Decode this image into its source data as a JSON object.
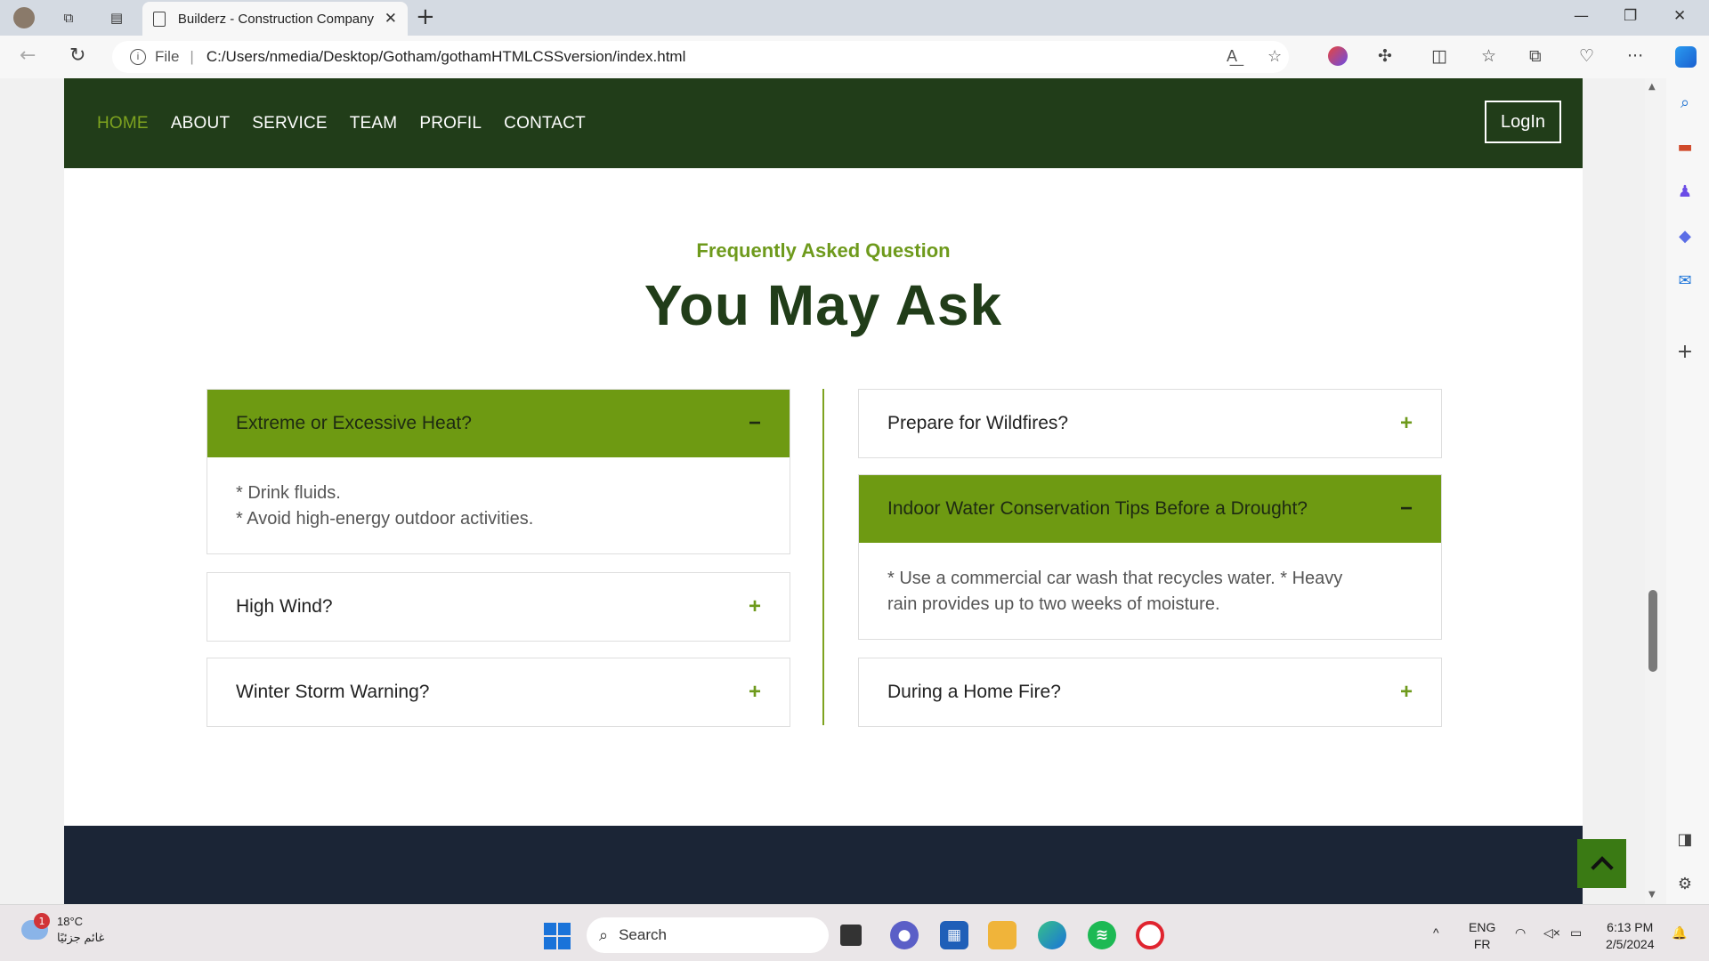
{
  "browser": {
    "tab_title": "Builderz - Construction Company",
    "tab_close": "✕",
    "new_tab": "+",
    "url_scheme_label": "File",
    "url": "C:/Users/nmedia/Desktop/Gotham/gothamHTMLCSSversion/index.html",
    "window_controls": {
      "minimize": "—",
      "restore": "❐",
      "close": "✕"
    },
    "more_label": "···"
  },
  "site": {
    "nav": {
      "items": [
        {
          "label": "HOME",
          "active": true
        },
        {
          "label": "ABOUT",
          "active": false
        },
        {
          "label": "SERVICE",
          "active": false
        },
        {
          "label": "TEAM",
          "active": false
        },
        {
          "label": "PROFIL",
          "active": false
        },
        {
          "label": "CONTACT",
          "active": false
        }
      ],
      "login_label": "LogIn"
    },
    "faq": {
      "eyebrow": "Frequently Asked Question",
      "heading": "You May Ask",
      "left": [
        {
          "question": "Extreme or Excessive Heat?",
          "open": true,
          "sign": "−",
          "answer_lines": [
            "* Drink fluids.",
            "* Avoid high-energy outdoor activities."
          ]
        },
        {
          "question": "High Wind?",
          "open": false,
          "sign": "+"
        },
        {
          "question": "Winter Storm Warning?",
          "open": false,
          "sign": "+"
        }
      ],
      "right": [
        {
          "question": "Prepare for Wildfires?",
          "open": false,
          "sign": "+"
        },
        {
          "question": "Indoor Water Conservation Tips Before a Drought?",
          "open": true,
          "sign": "−",
          "answer_lines": [
            "* Use a commercial car wash that recycles water. * Heavy",
            "rain provides up to two weeks of moisture."
          ]
        },
        {
          "question": "During a Home Fire?",
          "open": false,
          "sign": "+"
        }
      ]
    }
  },
  "taskbar": {
    "weather": {
      "temp": "18°C",
      "desc": "غائم جزئيًا",
      "badge": "1"
    },
    "search_label": "Search",
    "language": {
      "line1": "ENG",
      "line2": "FR"
    },
    "clock": {
      "time": "6:13 PM",
      "date": "2/5/2024"
    }
  },
  "colors": {
    "nav_bg": "#213d19",
    "accent_green": "#6e9a12",
    "footer_bg": "#1b2536",
    "back_to_top": "#3a7a14"
  }
}
